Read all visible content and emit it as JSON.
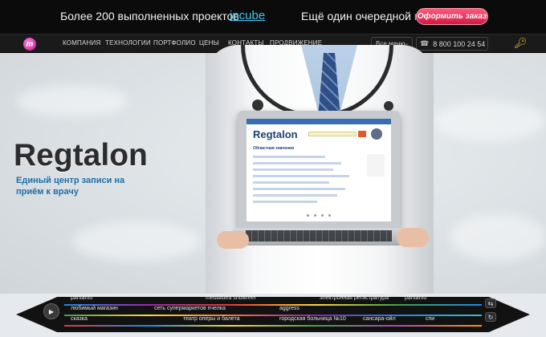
{
  "promo": {
    "projects_text": "Более 200 выполненных проектов",
    "link": "incube",
    "plus_text": "Ещё один очередной плюс",
    "order_button": "Оформить заказ"
  },
  "nav": {
    "logo_letter": "m",
    "items": [
      "КОМПАНИЯ",
      "ТЕХНОЛОГИИ",
      "ПОРТФОЛИО",
      "ЦЕНЫ",
      "КОНТАКТЫ",
      "ПРОДВИЖЕНИЕ"
    ],
    "all_menu": "Все меню",
    "phone": "8 800 100 24 54"
  },
  "hero": {
    "title": "Regtalon",
    "subtitle": "Единый центр записи на приём к врачу",
    "screen_title": "Regtalon",
    "screen_subtitle": "Областная значения"
  },
  "projects": {
    "row1": [
      "pantamo",
      "mediaidea showreel",
      "электронная регистратура",
      "pantamo"
    ],
    "row2": [
      "любимый магазин",
      "сеть супермаркетов пчелка",
      "aggress"
    ],
    "row3": [
      "сказка",
      "театр оперы и балета",
      "городская больница №10",
      "сансара-ойл",
      "спи"
    ]
  },
  "colors": {
    "promo_bg": "#0b0b0b",
    "accent_link": "#3fc7f0",
    "order_button": "#d11845",
    "subtitle_blue": "#1f6ea8"
  }
}
